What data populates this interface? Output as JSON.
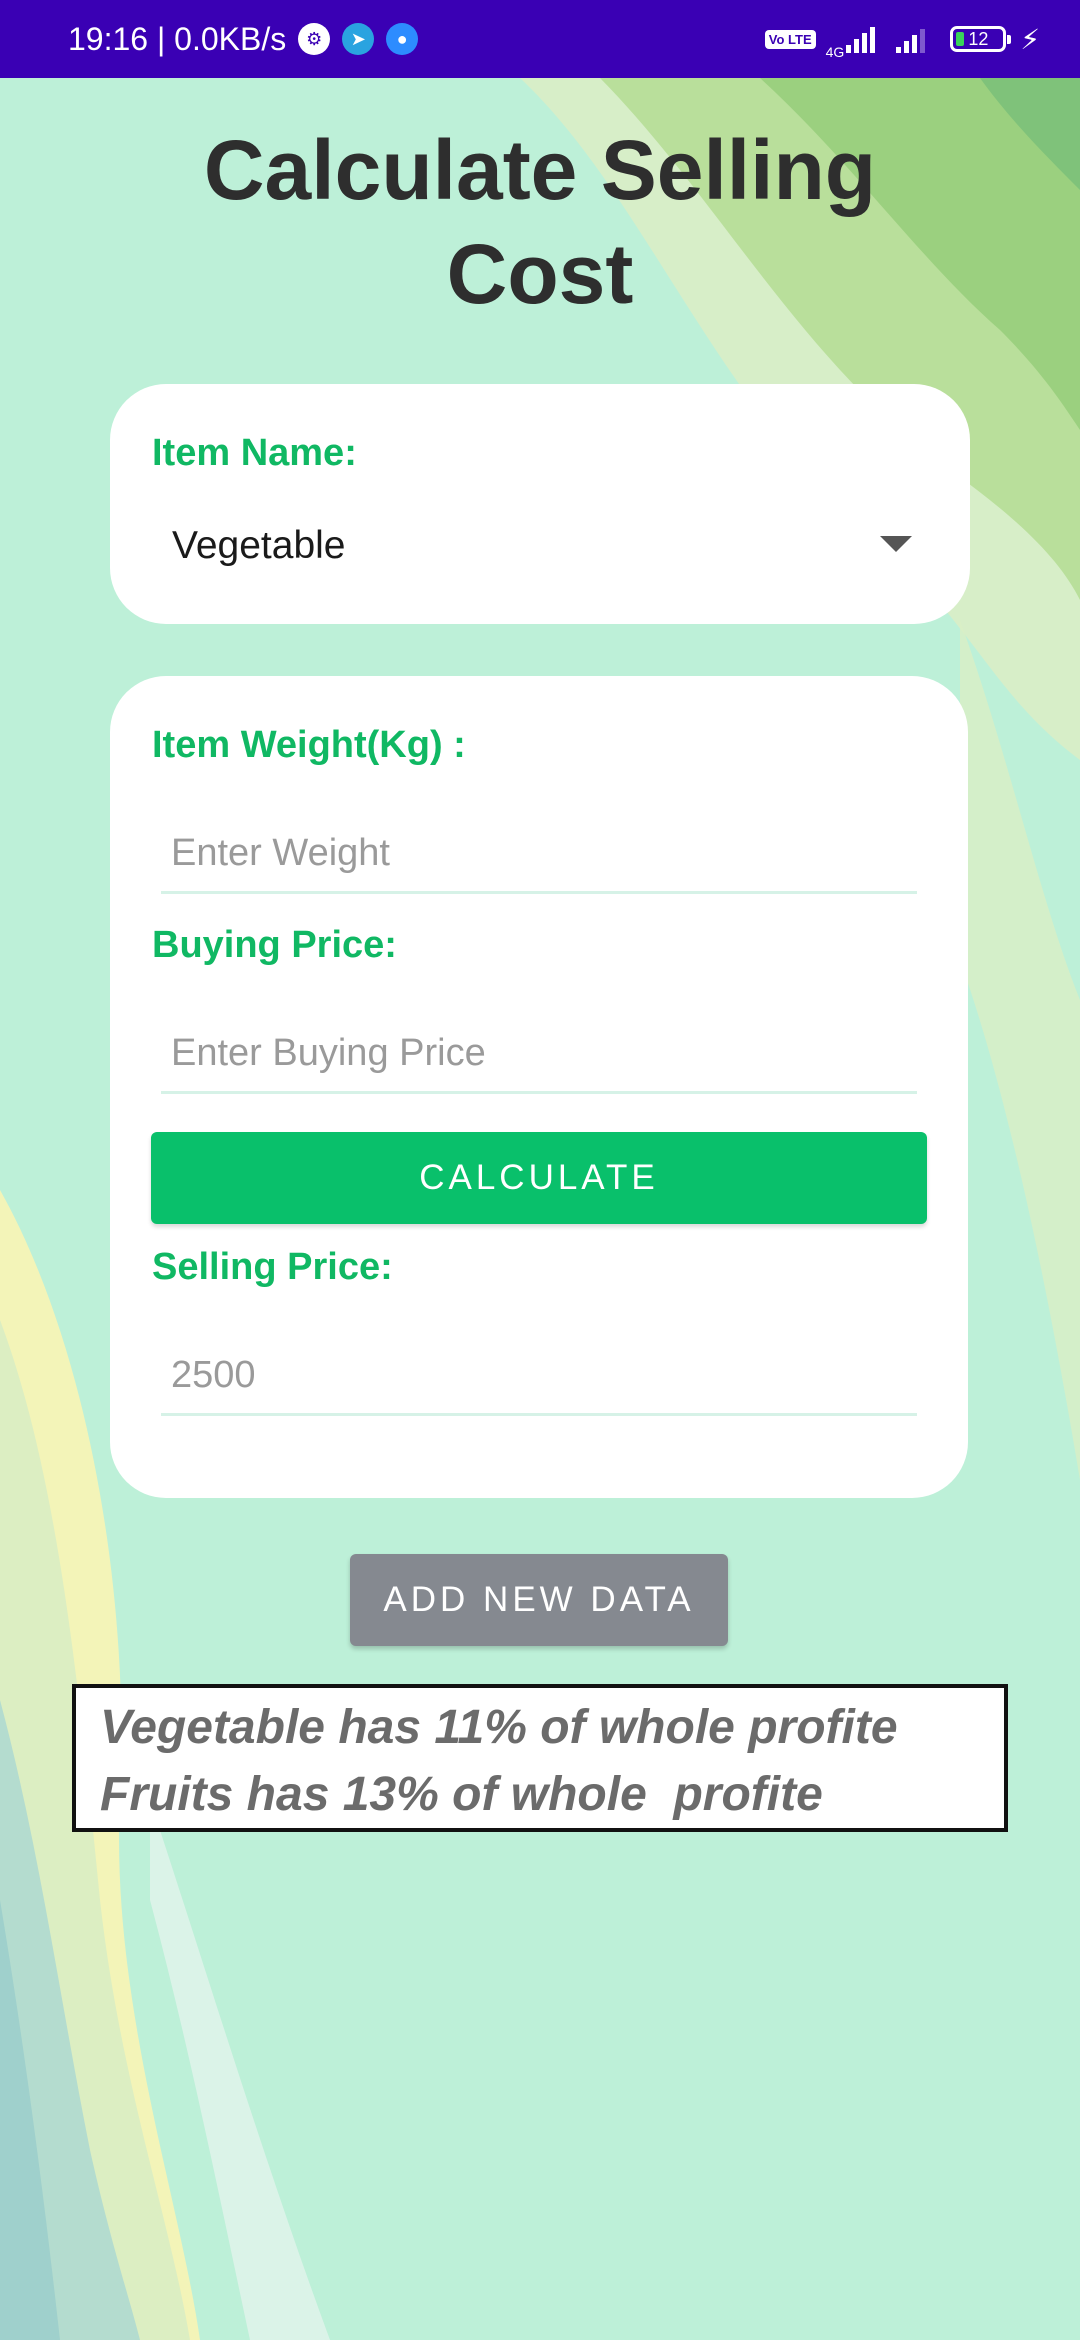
{
  "status_bar": {
    "time_speed": "19:16 | 0.0KB/s",
    "network_badge": "Vo LTE",
    "network_type": "4G",
    "battery_level": "12",
    "app_icons": [
      "settings-icon",
      "telegram-icon",
      "video-call-icon"
    ]
  },
  "page": {
    "title_line1": "Calculate Selling",
    "title_line2": "Cost"
  },
  "item_card": {
    "label": "Item Name:",
    "selected": "Vegetable"
  },
  "form_card": {
    "weight_label": "Item Weight(Kg) :",
    "weight_placeholder": "Enter Weight",
    "buying_label": "Buying Price:",
    "buying_placeholder": "Enter Buying Price",
    "calculate_label": "CALCULATE",
    "selling_label": "Selling Price:",
    "selling_value": "2500"
  },
  "add_button_label": "ADD NEW DATA",
  "info": {
    "line1": "Vegetable has 11% of whole profite",
    "line2": "Fruits has 13% of whole  profite"
  },
  "colors": {
    "status_bar": "#3a00b4",
    "background": "#bdf0d8",
    "accent_green": "#09c06b",
    "label_green": "#10b863",
    "add_button_grey": "#858990",
    "title_text": "#2e2e2e"
  }
}
